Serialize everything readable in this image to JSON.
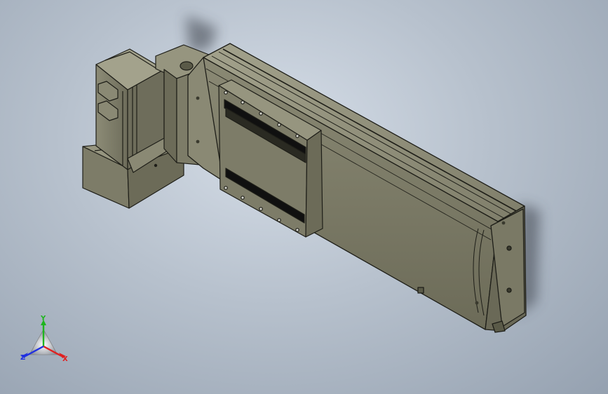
{
  "viewport": {
    "background_center": "#d6dee8",
    "background_edge": "#95a1b0"
  },
  "model": {
    "body_color": "#7d7c68",
    "body_light": "#96957f",
    "body_dark": "#5a5a48",
    "edge_color": "#1e1e18",
    "slot_color": "#101010",
    "shadow_color": "#3a3f48"
  },
  "triad": {
    "y_label": "Y",
    "x_label": "X",
    "z_label": "Z",
    "y_color": "#1fb51f",
    "x_color": "#e02020",
    "z_color": "#2030e0"
  }
}
